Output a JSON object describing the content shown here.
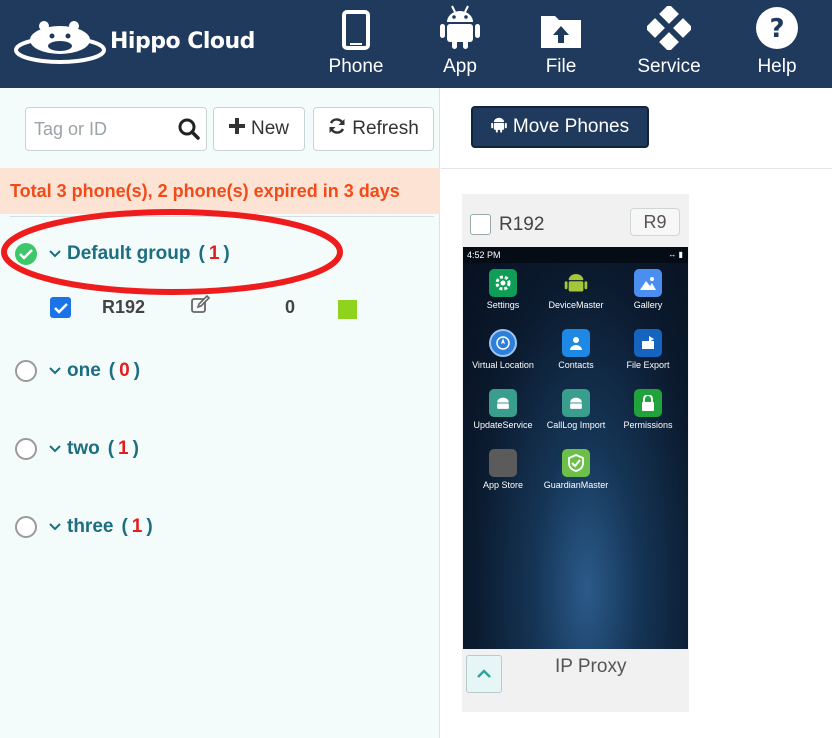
{
  "brand": {
    "name": "Hippo Cloud"
  },
  "nav": {
    "items": [
      {
        "label": "Phone",
        "icon": "phone-icon"
      },
      {
        "label": "App",
        "icon": "android-icon"
      },
      {
        "label": "File",
        "icon": "file-upload-icon"
      },
      {
        "label": "Service",
        "icon": "service-icon"
      },
      {
        "label": "Help",
        "icon": "help-icon"
      }
    ]
  },
  "toolbar": {
    "search_placeholder": "Tag or ID",
    "search_value": "",
    "new_label": "New",
    "refresh_label": "Refresh"
  },
  "banner": {
    "text": "Total 3 phone(s), 2 phone(s) expired in 3 days"
  },
  "groups": [
    {
      "name": "Default group",
      "count": "1",
      "selected": true
    },
    {
      "name": "one",
      "count": "0",
      "selected": false
    },
    {
      "name": "two",
      "count": "1",
      "selected": false
    },
    {
      "name": "three",
      "count": "1",
      "selected": false
    }
  ],
  "group_phone": {
    "id": "R192",
    "number": "0",
    "checked": true,
    "status_color": "#8fd31e"
  },
  "actions": {
    "move_label": "Move Phones"
  },
  "phone_card": {
    "id": "R192",
    "badge": "R9",
    "status_time": "4:52 PM",
    "apps": [
      {
        "label": "Settings",
        "icon": "settings-icon"
      },
      {
        "label": "DeviceMaster",
        "icon": "android-icon"
      },
      {
        "label": "Gallery",
        "icon": "gallery-icon"
      },
      {
        "label": "Virtual Location",
        "icon": "location-icon"
      },
      {
        "label": "Contacts",
        "icon": "contacts-icon"
      },
      {
        "label": "File Export",
        "icon": "file-export-icon"
      },
      {
        "label": "UpdateService",
        "icon": "android-icon"
      },
      {
        "label": "CallLog Import",
        "icon": "android-icon"
      },
      {
        "label": "Permissions",
        "icon": "lock-icon"
      },
      {
        "label": "App Store",
        "icon": "app-store-icon"
      },
      {
        "label": "GuardianMaster",
        "icon": "shield-icon"
      }
    ],
    "footer_label": "IP Proxy"
  },
  "colors": {
    "nav_bg": "#1f3a5c",
    "accent_teal": "#1d6e80",
    "warning_text": "#f24b1a",
    "warning_bg": "#fde3d3",
    "count_red": "#e02020",
    "annotation_red": "#ee1c1c"
  }
}
